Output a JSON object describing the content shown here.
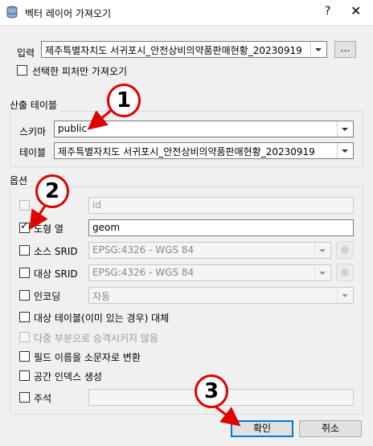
{
  "window": {
    "title": "벡터 레이어 가져오기",
    "help_glyph": "?",
    "close_glyph": "✕"
  },
  "input_row": {
    "label": "입력",
    "value": "제주특별자치도 서귀포시_안전상비의약품판매현황_20230919",
    "browse_label": "…"
  },
  "selected_only": {
    "label": "선택한 피처만 가져오기",
    "checked": false
  },
  "output_table": {
    "group_title": "산출 테이블",
    "schema_label": "스키마",
    "schema_value": "public",
    "table_label": "테이블",
    "table_value": "제주특별자치도 서귀포시_안전상비의약품판매현황_20230919"
  },
  "options": {
    "group_title": "옵션",
    "primary_key": {
      "label": "",
      "value": "id",
      "checked": false,
      "enabled": false
    },
    "geometry_column": {
      "label": "도형 열",
      "value": "geom",
      "checked": true
    },
    "source_srid": {
      "label": "소스 SRID",
      "value": "EPSG:4326 - WGS 84",
      "checked": false
    },
    "target_srid": {
      "label": "대상 SRID",
      "value": "EPSG:4326 - WGS 84",
      "checked": false
    },
    "encoding": {
      "label": "인코딩",
      "value": "자동",
      "checked": false
    },
    "replace_table": {
      "label": "대상 테이블(이미 있는 경우) 대체",
      "checked": false
    },
    "no_multi": {
      "label": "다중 부분으로 승격시키지 않음",
      "checked": false,
      "enabled": false
    },
    "lowercase": {
      "label": "필드 이름을 소문자로 변환",
      "checked": false
    },
    "spatial_index": {
      "label": "공간 인덱스 생성",
      "checked": false
    },
    "comment": {
      "label": "주석",
      "value": "",
      "checked": false
    }
  },
  "buttons": {
    "ok": "확인",
    "cancel": "취소"
  },
  "annotations": [
    "1",
    "2",
    "3"
  ],
  "colors": {
    "annotation": "#e00000",
    "default_button_border": "#0078d7"
  }
}
